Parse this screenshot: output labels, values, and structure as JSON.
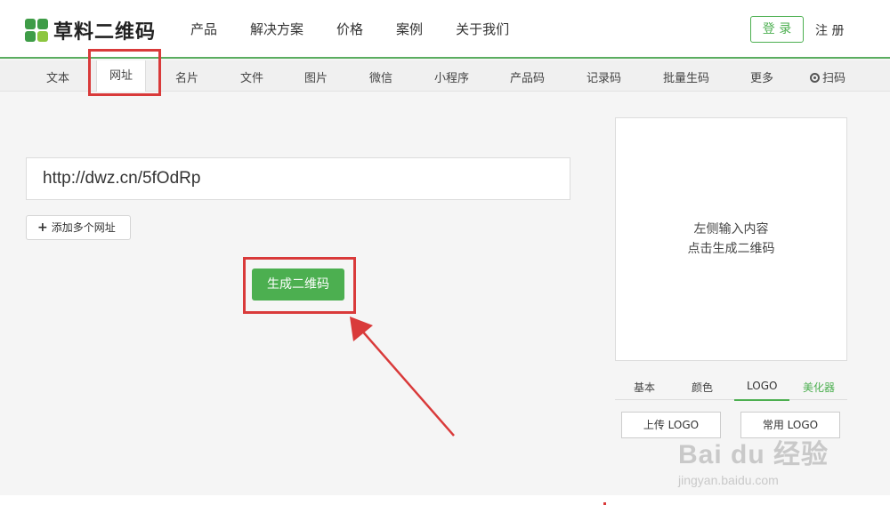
{
  "header": {
    "logo_text": "草料二维码",
    "nav": [
      "产品",
      "解决方案",
      "价格",
      "案例",
      "关于我们"
    ],
    "login_label": "登 录",
    "register_label": "注 册"
  },
  "tabs": [
    "文本",
    "网址",
    "名片",
    "文件",
    "图片",
    "微信",
    "小程序",
    "产品码",
    "记录码",
    "批量生码",
    "更多",
    "扫码"
  ],
  "active_tab": "网址",
  "main": {
    "url_value": "http://dwz.cn/5fOdRp",
    "add_url_label": "添加多个网址",
    "generate_label": "生成二维码"
  },
  "preview": {
    "line1": "左侧输入内容",
    "line2": "点击生成二维码"
  },
  "style_tabs": [
    "基本",
    "颜色",
    "LOGO",
    "美化器"
  ],
  "logo_buttons": [
    "上传 LOGO",
    "常用 LOGO"
  ],
  "watermark": {
    "main": "Bai du 经验",
    "sub": "jingyan.baidu.com"
  },
  "colors": {
    "brand_green": "#4caf50",
    "highlight_red": "#d93a3a"
  }
}
